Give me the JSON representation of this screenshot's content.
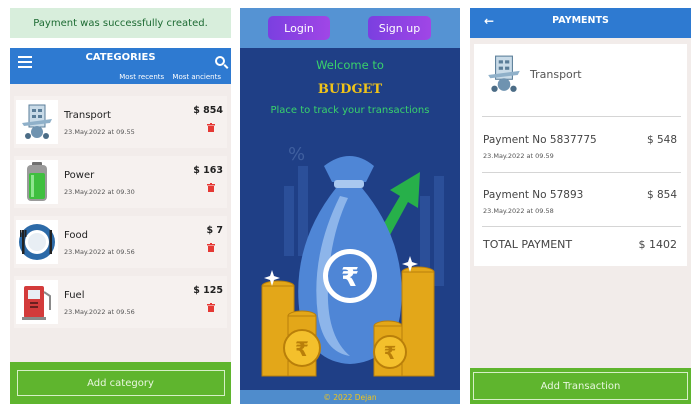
{
  "categories_screen": {
    "toast": "Payment was successfully created.",
    "header": {
      "title": "CATEGORIES",
      "sort_recent": "Most recents",
      "sort_ancient": "Most ancients"
    },
    "items": [
      {
        "name": "Transport",
        "amount": "$ 854",
        "date": "23.May.2022 at 09.55",
        "icon": "transport-icon"
      },
      {
        "name": "Power",
        "amount": "$ 163",
        "date": "23.May.2022 at 09.30",
        "icon": "battery-icon"
      },
      {
        "name": "Food",
        "amount": "$ 7",
        "date": "23.May.2022 at 09.56",
        "icon": "plate-cutlery-icon"
      },
      {
        "name": "Fuel",
        "amount": "$ 125",
        "date": "23.May.2022 at 09.56",
        "icon": "fuel-pump-icon"
      }
    ],
    "add_button": "Add category"
  },
  "welcome_screen": {
    "login": "Login",
    "signup": "Sign up",
    "welcome": "Welcome to",
    "brand": "BUDGET",
    "tagline": "Place to track your transactions",
    "rupee_symbol": "₹",
    "chart_glyph": "%",
    "footer": "© 2022 Dejan"
  },
  "payments_screen": {
    "header": {
      "title": "PAYMENTS",
      "back_icon": "arrow-left-icon"
    },
    "category": "Transport",
    "payments": [
      {
        "label": "Payment No 5837775",
        "amount": "$ 548",
        "date": "23.May.2022 at 09.59"
      },
      {
        "label": "Payment No 57893",
        "amount": "$ 854",
        "date": "23.May.2022 at 09.58"
      }
    ],
    "total_label": "TOTAL PAYMENT",
    "total_amount": "$ 1402",
    "add_button": "Add Transaction"
  },
  "colors": {
    "header_blue": "#2e7ad1",
    "footer_green": "#5fb52e",
    "welcome_navy": "#1f3f86",
    "brand_gold": "#f0c419",
    "welcome_green": "#39d26b",
    "delete_red": "#e53935"
  }
}
